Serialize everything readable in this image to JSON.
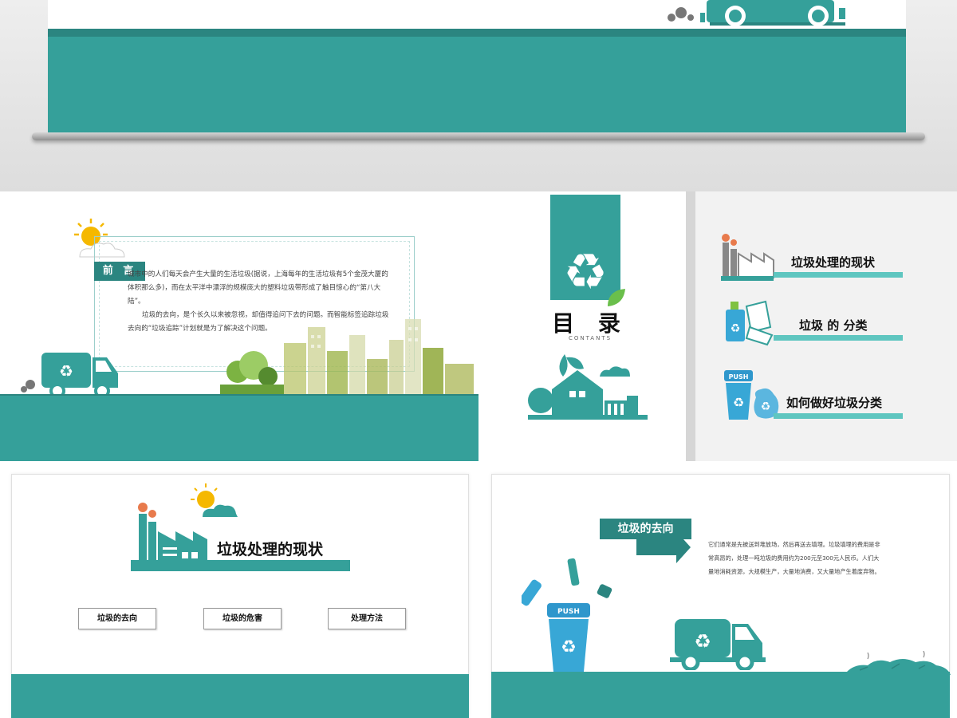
{
  "slide2": {
    "tag": "前 言",
    "para1": "城市中的人们每天会产生大量的生活垃圾(据说，上海每年的生活垃圾有5个金茂大厦的体积那么多)，而在太平洋中漂浮的规模庞大的塑料垃圾带形成了触目惊心的“第八大陆”。",
    "para2": "垃圾的去向，是个长久以来被忽视，却值得追问下去的问题。而智能标签追踪垃圾去向的“垃圾追踪”计划就是为了解决这个问题。"
  },
  "slide3": {
    "title": "目 录",
    "subtitle": "CONTANTS",
    "items": [
      {
        "label": "垃圾处理的现状"
      },
      {
        "label": "垃圾 的 分类"
      },
      {
        "label": "如何做好垃圾分类"
      }
    ]
  },
  "slide4": {
    "title": "垃圾处理的现状",
    "buttons": [
      "垃圾的去向",
      "垃圾的危害",
      "处理方法"
    ]
  },
  "slide5": {
    "arrow_label": "垃圾的去向",
    "push_label": "PUSH",
    "description": "它们通常是先被送到堆放场，然后再送去填埋。垃圾填埋的费用是非常高昂的，处理一吨垃圾的费用约为200元至300元人民币。人们大量地消耗资源，大规模生产，大量地消费，又大量地产生着废弃物。"
  },
  "slide3_push_label": "PUSH",
  "colors": {
    "teal": "#35a09a",
    "teal_dark": "#2b8580",
    "teal_light": "#5fc6c0",
    "sun": "#f5b800"
  }
}
